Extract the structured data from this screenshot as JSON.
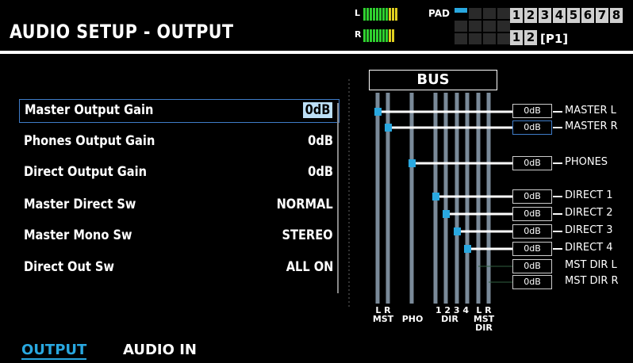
{
  "header": {
    "title": "AUDIO SETUP - OUTPUT",
    "meter_left_label": "L",
    "meter_right_label": "R",
    "pad_label": "PAD",
    "channels_top": [
      "1",
      "2",
      "3",
      "4",
      "5",
      "6",
      "7",
      "8"
    ],
    "channels_bottom": [
      "1",
      "2"
    ],
    "part_label": "[P1]"
  },
  "params": [
    {
      "name": "Master Output Gain",
      "value": "0dB"
    },
    {
      "name": "Phones Output Gain",
      "value": "0dB"
    },
    {
      "name": "Direct Output Gain",
      "value": "0dB"
    },
    {
      "name": "Master Direct Sw",
      "value": "NORMAL"
    },
    {
      "name": "Master Mono Sw",
      "value": "STEREO"
    },
    {
      "name": "Direct Out Sw",
      "value": "ALL ON"
    }
  ],
  "diagram": {
    "bus_label": "BUS",
    "outputs": [
      {
        "gain": "0dB",
        "label": "MASTER L"
      },
      {
        "gain": "0dB",
        "label": "MASTER R"
      },
      {
        "gain": "0dB",
        "label": "PHONES"
      },
      {
        "gain": "0dB",
        "label": "DIRECT 1"
      },
      {
        "gain": "0dB",
        "label": "DIRECT 2"
      },
      {
        "gain": "0dB",
        "label": "DIRECT 3"
      },
      {
        "gain": "0dB",
        "label": "DIRECT 4"
      },
      {
        "gain": "0dB",
        "label": "MST DIR L"
      },
      {
        "gain": "0dB",
        "label": "MST DIR R"
      }
    ],
    "column_labels": {
      "mst_lr": "L R",
      "mst": "MST",
      "pho": "PHO",
      "dir_nums": "1 2 3 4",
      "dir": "DIR",
      "mstdir_lr": "L R",
      "mstdir_mst": "MST",
      "mstdir_dir": "DIR"
    }
  },
  "tabs": {
    "output": "OUTPUT",
    "audio_in": "AUDIO IN"
  },
  "colors": {
    "accent": "#29a8e0",
    "selection_border": "#3f7cc8",
    "meter_green": "#2fd12f",
    "meter_yellow": "#e0d020"
  }
}
